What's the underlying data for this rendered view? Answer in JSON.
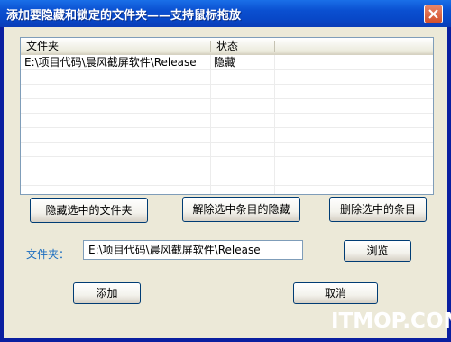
{
  "window": {
    "title": "添加要隐藏和锁定的文件夹——支持鼠标拖放"
  },
  "list": {
    "columns": [
      "文件夹",
      "状态"
    ],
    "rows": [
      {
        "folder": "E:\\项目代码\\晨风截屏软件\\Release",
        "status": "隐藏"
      }
    ]
  },
  "buttons": {
    "hide_selected": "隐藏选中的文件夹",
    "unhide_selected": "解除选中条目的隐藏",
    "delete_selected": "删除选中的条目",
    "browse": "浏览",
    "add": "添加",
    "cancel": "取消"
  },
  "form": {
    "folder_label": "文件夹：",
    "folder_value": "E:\\项目代码\\晨风截屏软件\\Release"
  },
  "watermark": "ITMOP.COM"
}
